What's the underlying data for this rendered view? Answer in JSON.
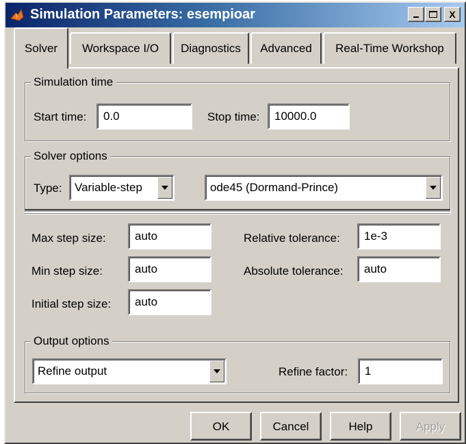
{
  "window": {
    "title": "Simulation Parameters: esempioar",
    "controls": {
      "minimize": "_",
      "maximize": "□",
      "close": "X"
    }
  },
  "tabs": [
    {
      "label": "Solver",
      "active": true
    },
    {
      "label": "Workspace I/O",
      "active": false
    },
    {
      "label": "Diagnostics",
      "active": false
    },
    {
      "label": "Advanced",
      "active": false
    },
    {
      "label": "Real-Time Workshop",
      "active": false
    }
  ],
  "simulation_time": {
    "legend": "Simulation time",
    "start_label": "Start time:",
    "start_value": "0.0",
    "stop_label": "Stop time:",
    "stop_value": "10000.0"
  },
  "solver_options": {
    "legend": "Solver options",
    "type_label": "Type:",
    "type_value": "Variable-step",
    "solver_value": "ode45 (Dormand-Prince)",
    "max_step_label": "Max step size:",
    "max_step_value": "auto",
    "min_step_label": "Min step size:",
    "min_step_value": "auto",
    "initial_step_label": "Initial step size:",
    "initial_step_value": "auto",
    "rel_tol_label": "Relative tolerance:",
    "rel_tol_value": "1e-3",
    "abs_tol_label": "Absolute tolerance:",
    "abs_tol_value": "auto"
  },
  "output_options": {
    "legend": "Output options",
    "output_value": "Refine output",
    "refine_label": "Refine factor:",
    "refine_value": "1"
  },
  "buttons": {
    "ok": "OK",
    "cancel": "Cancel",
    "help": "Help",
    "apply": "Apply"
  },
  "colors": {
    "dialog_bg": "#d4d0c8",
    "title_start": "#0a246a",
    "title_end": "#a6caf0"
  }
}
